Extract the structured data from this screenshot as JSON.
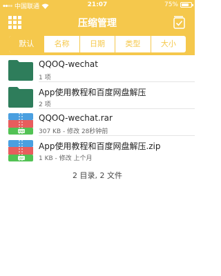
{
  "status_bar": {
    "carrier": "中国联通",
    "time": "21:07",
    "battery_text": "75%",
    "battery_level": 0.75
  },
  "nav": {
    "title": "压缩管理",
    "menu_icon": "grid-icon",
    "select_icon": "select-all-icon"
  },
  "sort_tabs": [
    {
      "label": "默认",
      "active": true
    },
    {
      "label": "名称",
      "active": false
    },
    {
      "label": "日期",
      "active": false
    },
    {
      "label": "类型",
      "active": false
    },
    {
      "label": "大小",
      "active": false
    }
  ],
  "files": [
    {
      "name": "QQOQ-wechat",
      "detail": "1 项",
      "type": "folder-icon"
    },
    {
      "name": "App使用教程和百度网盘解压",
      "detail": "2 项",
      "type": "folder-icon"
    },
    {
      "name": "QQOQ-wechat.rar",
      "detail": "307 KB - 修改 28秒钟前",
      "type": "rar-archive-icon",
      "badge": "RAR"
    },
    {
      "name": "App使用教程和百度网盘解压.zip",
      "detail": "1 KB - 修改 上个月",
      "type": "zip-archive-icon",
      "badge": "ZIP"
    }
  ],
  "summary": "2 目录, 2 文件",
  "colors": {
    "accent": "#f5c84c",
    "folder": "#2e7d5b",
    "archive_blue": "#4a9fe0",
    "archive_red": "#e85d5d",
    "archive_green": "#52c254"
  }
}
